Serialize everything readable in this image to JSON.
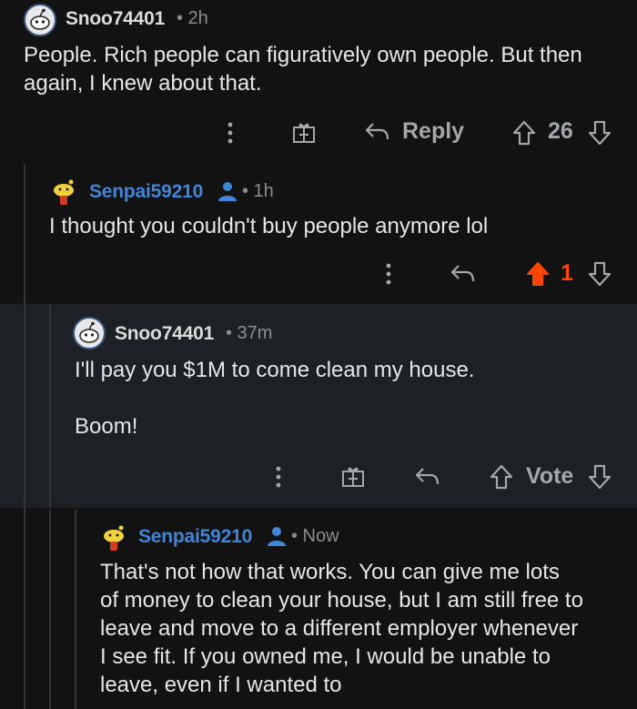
{
  "colors": {
    "background": "#121213",
    "highlight": "#1d2125",
    "upvote": "#ff4500",
    "username_blue": "#3d86d8"
  },
  "comments": [
    {
      "username": "Snoo74401",
      "time": "• 2h",
      "body": [
        "People. Rich people can figuratively own people. But then",
        "again, I knew about that."
      ],
      "actions": {
        "more_icon": "more-vertical-icon",
        "award_icon": "gift-icon",
        "reply_label": "Reply",
        "score": "26"
      }
    },
    {
      "username": "Senpai59210",
      "time": "• 1h",
      "body": [
        "I thought you couldn't buy people anymore lol"
      ],
      "actions": {
        "score": "1",
        "upvoted": true
      }
    },
    {
      "username": "Snoo74401",
      "time": "• 37m",
      "body": [
        "I'll pay you $1M to come clean my house.",
        "",
        "Boom!"
      ],
      "actions": {
        "vote_label": "Vote"
      }
    },
    {
      "username": "Senpai59210",
      "time": "• Now",
      "body": [
        "That's not how that works. You can give me lots",
        "of money to clean your house, but I am still free to",
        "leave and move to a different employer whenever",
        "I see fit. If you owned me, I would be unable to",
        "leave, even if I wanted to"
      ]
    }
  ]
}
